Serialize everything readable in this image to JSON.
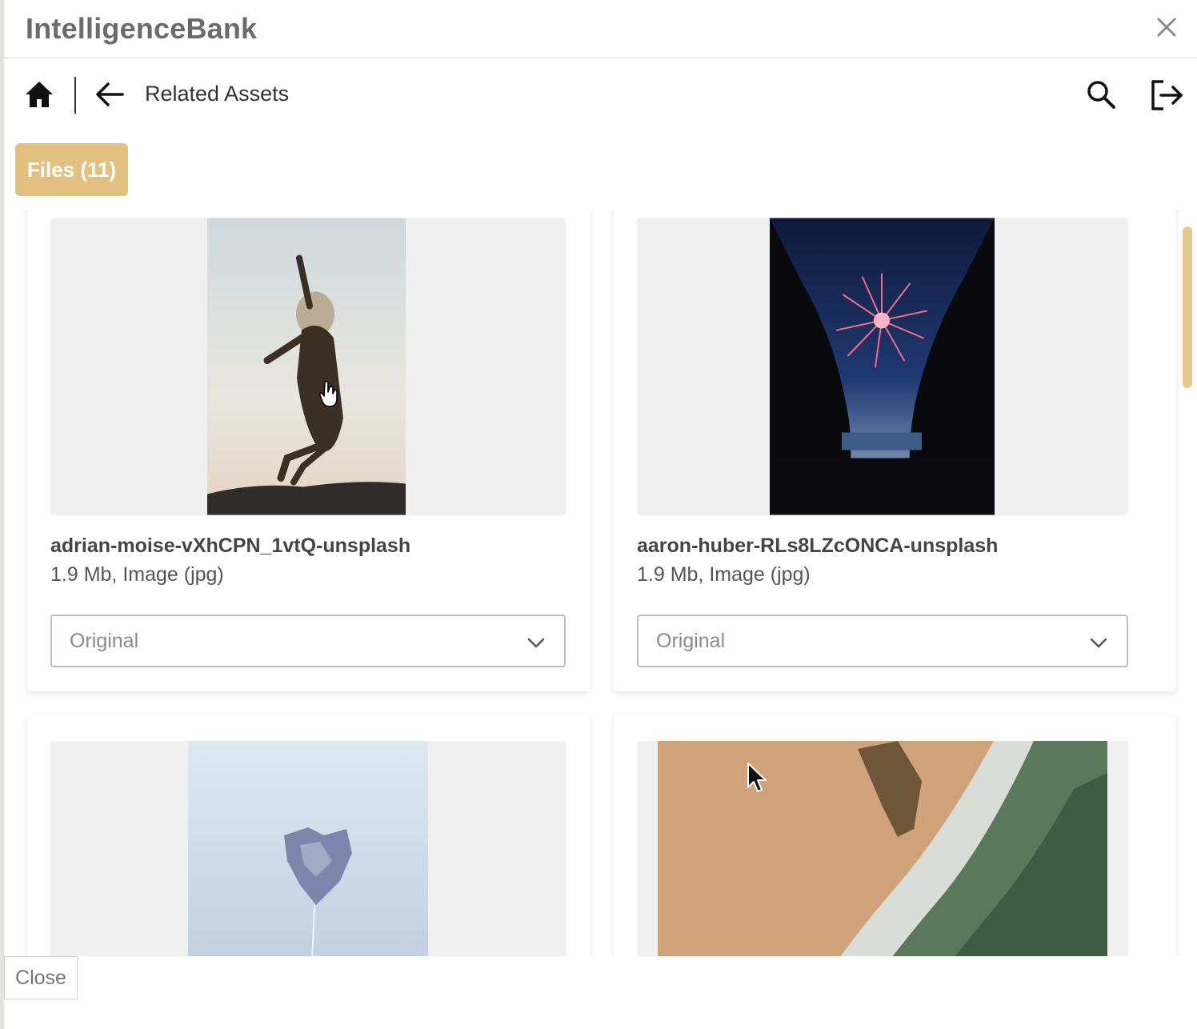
{
  "window": {
    "title": "IntelligenceBank",
    "close_icon": "close-icon"
  },
  "nav": {
    "title": "Related Assets",
    "icons": [
      "home-icon",
      "back-arrow-icon",
      "search-icon",
      "logout-icon"
    ]
  },
  "tabs": {
    "files_label": "Files (11)"
  },
  "assets": [
    {
      "name": "adrian-moise-vXhCPN_1vtQ-unsplash",
      "meta": "1.9 Mb, Image (jpg)",
      "variant": "Original"
    },
    {
      "name": "aaron-huber-RLs8LZcONCA-unsplash",
      "meta": "1.9 Mb, Image (jpg)",
      "variant": "Original"
    },
    {
      "name": "",
      "meta": "",
      "variant": ""
    },
    {
      "name": "",
      "meta": "",
      "variant": ""
    }
  ],
  "footer": {
    "close_label": "Close"
  },
  "colors": {
    "accent": "#e2c07f",
    "scrollbar": "#e6c98e",
    "title_text": "#6b6b6b"
  }
}
